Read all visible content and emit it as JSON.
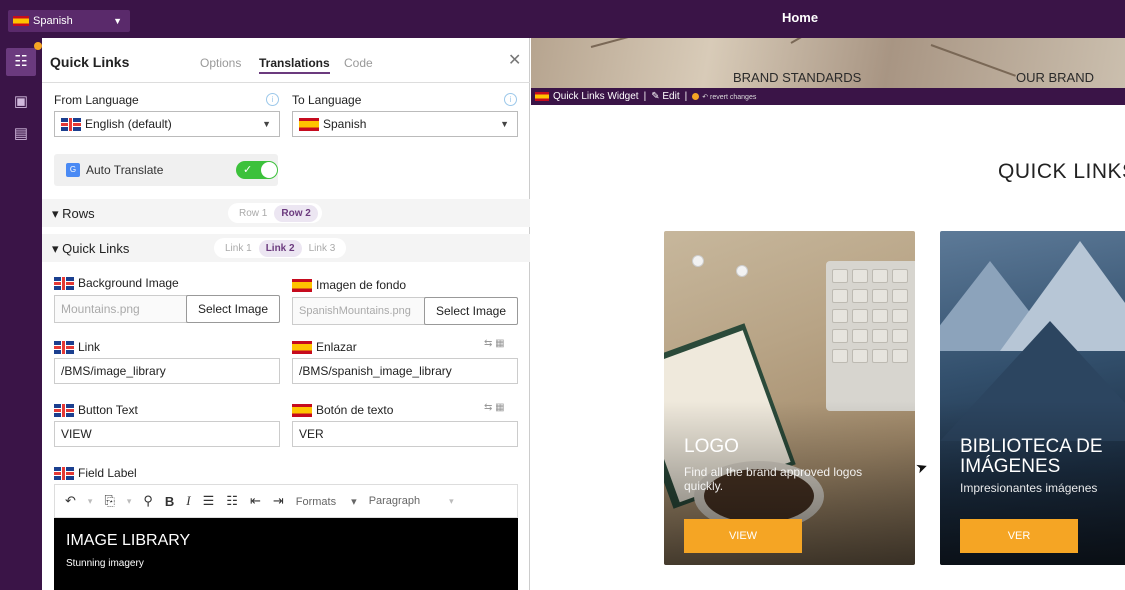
{
  "topbar": {
    "language": "Spanish",
    "page_title": "Home"
  },
  "panel": {
    "title": "Quick Links",
    "tabs": [
      "Options",
      "Translations",
      "Code"
    ],
    "active_tab": "Translations",
    "from_language_label": "From Language",
    "from_language_value": "English (default)",
    "to_language_label": "To Language",
    "to_language_value": "Spanish",
    "auto_translate_label": "Auto Translate",
    "auto_translate_on": true,
    "rows_section": {
      "label": "Rows",
      "items": [
        "Row 1",
        "Row 2"
      ],
      "active": "Row 2"
    },
    "links_section": {
      "label": "Quick Links",
      "items": [
        "Link 1",
        "Link 2",
        "Link 3"
      ],
      "active": "Link 2"
    },
    "fields": {
      "bg_image_label": "Background Image",
      "bg_image_value": "Mountains.png",
      "bg_image_es_label": "Imagen de fondo",
      "bg_image_es_value": "SpanishMountains.png",
      "select_image": "Select Image",
      "link_label": "Link",
      "link_value": "/BMS/image_library",
      "link_es_label": "Enlazar",
      "link_es_value": "/BMS/spanish_image_library",
      "button_text_label": "Button Text",
      "button_text_value": "VIEW",
      "button_text_es_label": "Botón de texto",
      "button_text_es_value": "VER",
      "field_label_label": "Field Label"
    },
    "editor": {
      "formats": "Formats",
      "paragraph": "Paragraph",
      "heading": "IMAGE LIBRARY",
      "body": "Stunning imagery"
    }
  },
  "preview": {
    "nav_items": [
      "BRAND STANDARDS",
      "OUR BRAND"
    ],
    "widget_bar": {
      "name": "Quick Links Widget",
      "edit": "Edit",
      "revert": "revert changes"
    },
    "section_title": "QUICK LINKS",
    "cards": [
      {
        "title": "LOGO",
        "desc": "Find all the brand approved logos quickly.",
        "button": "VIEW"
      },
      {
        "title": "BIBLIOTECA DE IMÁGENES",
        "desc": "Impresionantes imágenes",
        "button": "VER"
      }
    ]
  },
  "colors": {
    "brand_purple": "#3a1447",
    "accent_orange": "#f5a524",
    "toggle_green": "#3cc13b"
  }
}
